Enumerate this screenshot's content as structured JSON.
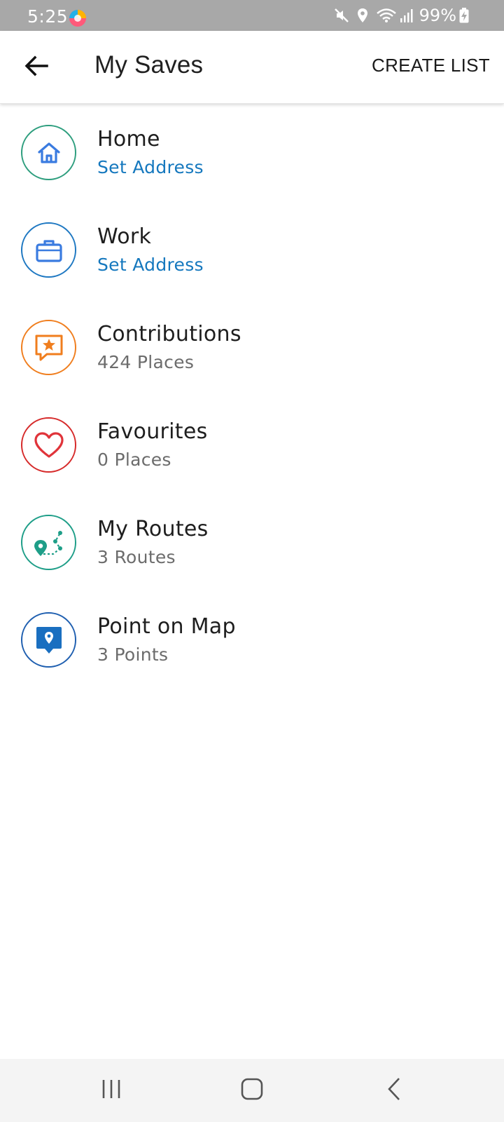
{
  "status_bar": {
    "time": "5:25",
    "battery": "99%",
    "icons": [
      "app-icon",
      "mute-icon",
      "location-icon",
      "wifi-icon",
      "signal-icon",
      "battery-charging-icon"
    ]
  },
  "app_bar": {
    "back_icon": "arrow-left-icon",
    "title": "My Saves",
    "action_label": "CREATE LIST"
  },
  "saves": [
    {
      "title": "Home",
      "subtitle": "Set Address",
      "subtitle_style": "link",
      "icon": "home-icon",
      "color": "#2e9e7e",
      "icon_color": "#3a7be0"
    },
    {
      "title": "Work",
      "subtitle": "Set Address",
      "subtitle_style": "link",
      "icon": "briefcase-icon",
      "color": "#1e78c2",
      "icon_color": "#3a7be0"
    },
    {
      "title": "Contributions",
      "subtitle": "424 Places",
      "subtitle_style": "muted",
      "icon": "star-speech-bubble-icon",
      "color": "#f07e1e",
      "icon_color": "#f07e1e"
    },
    {
      "title": "Favourites",
      "subtitle": "0 Places",
      "subtitle_style": "muted",
      "icon": "heart-icon",
      "color": "#d62a2a",
      "icon_color": "#e0343a"
    },
    {
      "title": "My Routes",
      "subtitle": "3 Routes",
      "subtitle_style": "muted",
      "icon": "route-icon",
      "color": "#1e9e88",
      "icon_color": "#1e9e88"
    },
    {
      "title": "Point on Map",
      "subtitle": "3 Points",
      "subtitle_style": "muted",
      "icon": "map-pin-icon",
      "color": "#1f5fb0",
      "icon_color": "#1a6fc0"
    }
  ],
  "nav_bar": {
    "buttons": [
      "recent-apps-icon",
      "home-nav-icon",
      "back-nav-icon"
    ]
  },
  "colors": {
    "status_bar_bg": "#a8a8a8",
    "link": "#1578be",
    "muted": "#6c6c6c",
    "nav_bar_bg": "#f4f4f4"
  }
}
